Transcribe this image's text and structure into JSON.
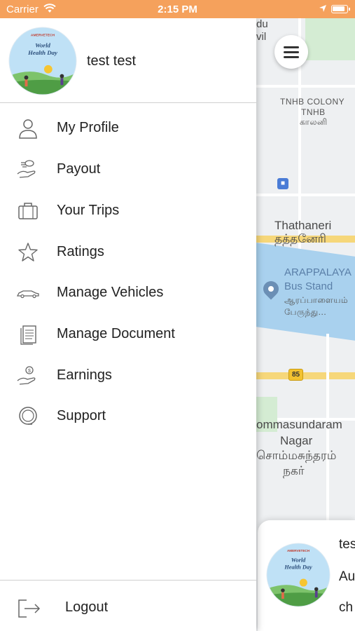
{
  "status_bar": {
    "carrier": "Carrier",
    "time": "2:15 PM"
  },
  "profile": {
    "name": "test test",
    "avatar_brand": "AMERVETECH",
    "avatar_title_line1": "World",
    "avatar_title_line2": "Health Day"
  },
  "menu": {
    "items": [
      {
        "label": "My Profile",
        "icon": "user-icon"
      },
      {
        "label": "Payout",
        "icon": "payout-hand-icon"
      },
      {
        "label": "Your Trips",
        "icon": "briefcase-icon"
      },
      {
        "label": "Ratings",
        "icon": "star-icon"
      },
      {
        "label": "Manage Vehicles",
        "icon": "car-icon"
      },
      {
        "label": "Manage Document",
        "icon": "document-icon"
      },
      {
        "label": "Earnings",
        "icon": "earnings-hand-icon"
      },
      {
        "label": "Support",
        "icon": "headset-icon"
      }
    ],
    "logout_label": "Logout"
  },
  "map": {
    "labels": {
      "top_partial_1": "du",
      "top_partial_2": "vil",
      "colony_en": "TNHB COLONY",
      "colony_en2": "TNHB",
      "colony_ta": "காலனி",
      "area1_en": "Thathaneri",
      "area1_ta": "தத்தனேரி",
      "busstand_en1": "ARAPPALAYA",
      "busstand_en2": "Bus Stand",
      "busstand_ta1": "ஆரப்பாளையம்",
      "busstand_ta2": "பேருந்து...",
      "road_shield": "85",
      "area2_en1": "ommasundaram",
      "area2_en2": "Nagar",
      "area2_ta1": "சொம்மசுந்தரம்",
      "area2_ta2": "நகர்"
    }
  },
  "trip_card": {
    "line1": "tes",
    "line2": "Au",
    "line3": "ch"
  },
  "colors": {
    "status_bar": "#f5a15c",
    "text": "#222222",
    "divider": "#cfcfcf"
  }
}
